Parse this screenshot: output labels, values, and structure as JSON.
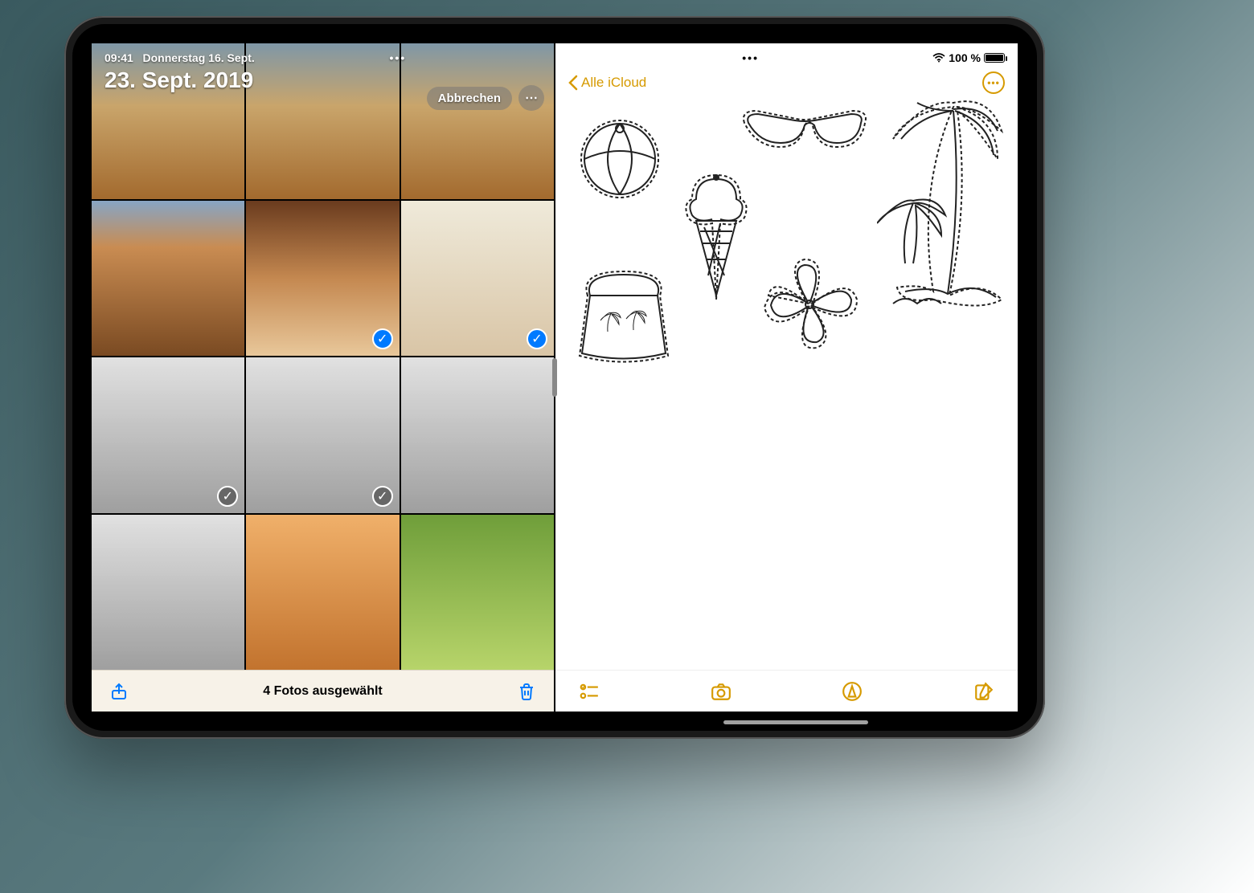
{
  "status": {
    "time": "09:41",
    "date": "Donnerstag 16. Sept.",
    "battery_text": "100 %"
  },
  "photos": {
    "title": "23. Sept. 2019",
    "cancel_label": "Abbrechen",
    "selection_text": "4 Fotos ausgewählt",
    "items": [
      {
        "style": "sky",
        "selected": false
      },
      {
        "style": "sky",
        "selected": false
      },
      {
        "style": "sky",
        "selected": false
      },
      {
        "style": "road",
        "selected": false
      },
      {
        "style": "canyon",
        "selected": true
      },
      {
        "style": "face",
        "selected": true
      },
      {
        "style": "bw",
        "selected": true
      },
      {
        "style": "bw",
        "selected": true
      },
      {
        "style": "bw",
        "selected": false
      },
      {
        "style": "bw",
        "selected": false
      },
      {
        "style": "sand",
        "selected": false
      },
      {
        "style": "green",
        "selected": false
      }
    ]
  },
  "notes": {
    "back_label": "Alle iCloud",
    "sketches": [
      "beach-ball",
      "sunglasses",
      "palm-tree",
      "ice-cream",
      "flower",
      "beach-bag"
    ]
  },
  "colors": {
    "ios_blue": "#007aff",
    "notes_yellow": "#d69a00"
  }
}
